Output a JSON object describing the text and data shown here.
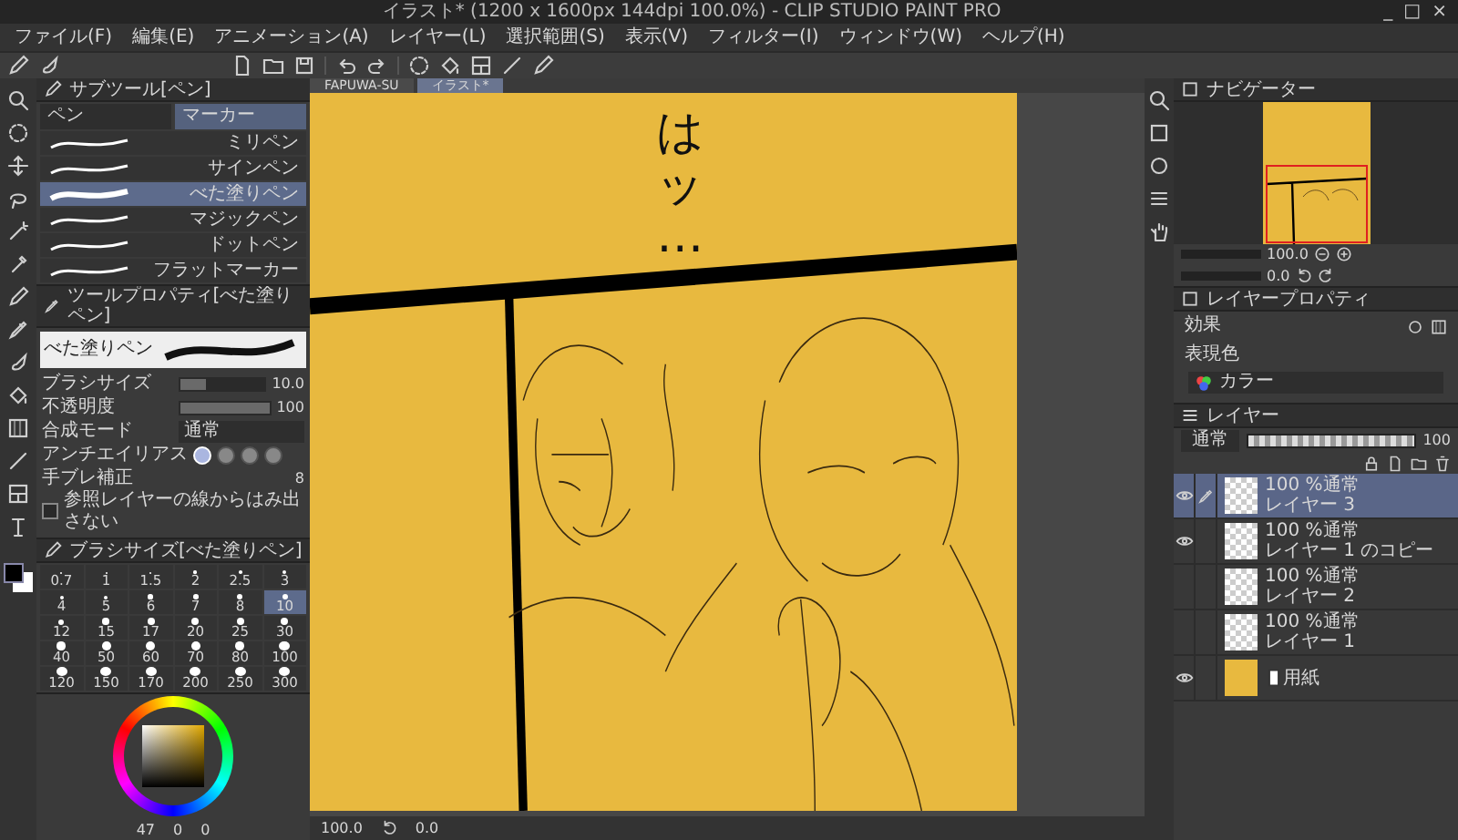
{
  "window": {
    "title": "イラスト* (1200 x 1600px 144dpi 100.0%) - CLIP STUDIO PAINT PRO",
    "controls": [
      "_",
      "□",
      "×"
    ]
  },
  "menu": [
    "ファイル(F)",
    "編集(E)",
    "アニメーション(A)",
    "レイヤー(L)",
    "選択範囲(S)",
    "表示(V)",
    "フィルター(I)",
    "ウィンドウ(W)",
    "ヘルプ(H)"
  ],
  "document_tabs": [
    {
      "label": "FAPUWA-SU",
      "selected": false
    },
    {
      "label": "イラスト*",
      "selected": true
    }
  ],
  "subtool": {
    "title": "サブツール[ペン]",
    "tabs": [
      {
        "label": "ペン",
        "selected": false
      },
      {
        "label": "マーカー",
        "selected": true
      }
    ],
    "items": [
      {
        "label": "ミリペン",
        "selected": false
      },
      {
        "label": "サインペン",
        "selected": false
      },
      {
        "label": "べた塗りペン",
        "selected": true
      },
      {
        "label": "マジックペン",
        "selected": false
      },
      {
        "label": "ドットペン",
        "selected": false
      },
      {
        "label": "フラットマーカー",
        "selected": false
      }
    ]
  },
  "tool_property": {
    "title": "ツールプロパティ[べた塗りペン]",
    "preview_label": "べた塗りペン",
    "rows": [
      {
        "kind": "slider",
        "label": "ブラシサイズ",
        "value": "10.0",
        "level": 0.3
      },
      {
        "kind": "slider",
        "label": "不透明度",
        "value": "100",
        "level": 1
      },
      {
        "kind": "dropdown",
        "label": "合成モード",
        "value": "通常"
      },
      {
        "kind": "choice",
        "label": "アンチエイリアス",
        "options": [
          {
            "selected": true
          },
          {
            "selected": false
          },
          {
            "selected": false
          },
          {
            "selected": false
          }
        ]
      },
      {
        "kind": "number",
        "label": "手ブレ補正",
        "value": "8"
      },
      {
        "kind": "checkbox",
        "label": "参照レイヤーの線からはみ出さない",
        "checked": false
      }
    ]
  },
  "brush_size": {
    "title": "ブラシサイズ[べた塗りペン]",
    "sizes": [
      {
        "label": "0.7",
        "selected": false
      },
      {
        "label": "1",
        "selected": false
      },
      {
        "label": "1.5",
        "selected": false
      },
      {
        "label": "2",
        "selected": false
      },
      {
        "label": "2.5",
        "selected": false
      },
      {
        "label": "3",
        "selected": false
      },
      {
        "label": "4",
        "selected": false
      },
      {
        "label": "5",
        "selected": false
      },
      {
        "label": "6",
        "selected": false
      },
      {
        "label": "7",
        "selected": false
      },
      {
        "label": "8",
        "selected": false
      },
      {
        "label": "10",
        "selected": true
      },
      {
        "label": "12",
        "selected": false
      },
      {
        "label": "15",
        "selected": false
      },
      {
        "label": "17",
        "selected": false
      },
      {
        "label": "20",
        "selected": false
      },
      {
        "label": "25",
        "selected": false
      },
      {
        "label": "30",
        "selected": false
      },
      {
        "label": "40",
        "selected": false
      },
      {
        "label": "50",
        "selected": false
      },
      {
        "label": "60",
        "selected": false
      },
      {
        "label": "70",
        "selected": false
      },
      {
        "label": "80",
        "selected": false
      },
      {
        "label": "100",
        "selected": false
      },
      {
        "label": "120",
        "selected": false
      },
      {
        "label": "150",
        "selected": false
      },
      {
        "label": "170",
        "selected": false
      },
      {
        "label": "200",
        "selected": false
      },
      {
        "label": "250",
        "selected": false
      },
      {
        "label": "300",
        "selected": false
      }
    ]
  },
  "color": {
    "readouts": [
      "47",
      "0",
      "0"
    ]
  },
  "canvas": {
    "lettering": "はッ…"
  },
  "navigator": {
    "title": "ナビゲーター",
    "zoom": "100.0",
    "angle": "0.0"
  },
  "layer_property": {
    "title": "レイヤープロパティ",
    "effect_label": "効果",
    "color_label": "表現色",
    "color_mode": "カラー"
  },
  "layers": {
    "title": "レイヤー",
    "blend_mode": "通常",
    "opacity": "100",
    "opacity_slider": {
      "level": 1
    },
    "items": [
      {
        "kind": "raster",
        "mode": "100 %通常",
        "name": "レイヤー 3",
        "visible": true,
        "selected": true,
        "editing": true
      },
      {
        "kind": "raster",
        "mode": "100 %通常",
        "name": "レイヤー 1 のコピー",
        "visible": true,
        "selected": false,
        "editing": false
      },
      {
        "kind": "raster",
        "mode": "100 %通常",
        "name": "レイヤー 2",
        "visible": false,
        "selected": false,
        "editing": false
      },
      {
        "kind": "raster",
        "mode": "100 %通常",
        "name": "レイヤー 1",
        "visible": false,
        "selected": false,
        "editing": false
      },
      {
        "kind": "paper",
        "name": "用紙",
        "visible": true,
        "selected": false,
        "editing": false
      }
    ]
  },
  "status": {
    "zoom": "100.0",
    "angle": "0.0"
  }
}
